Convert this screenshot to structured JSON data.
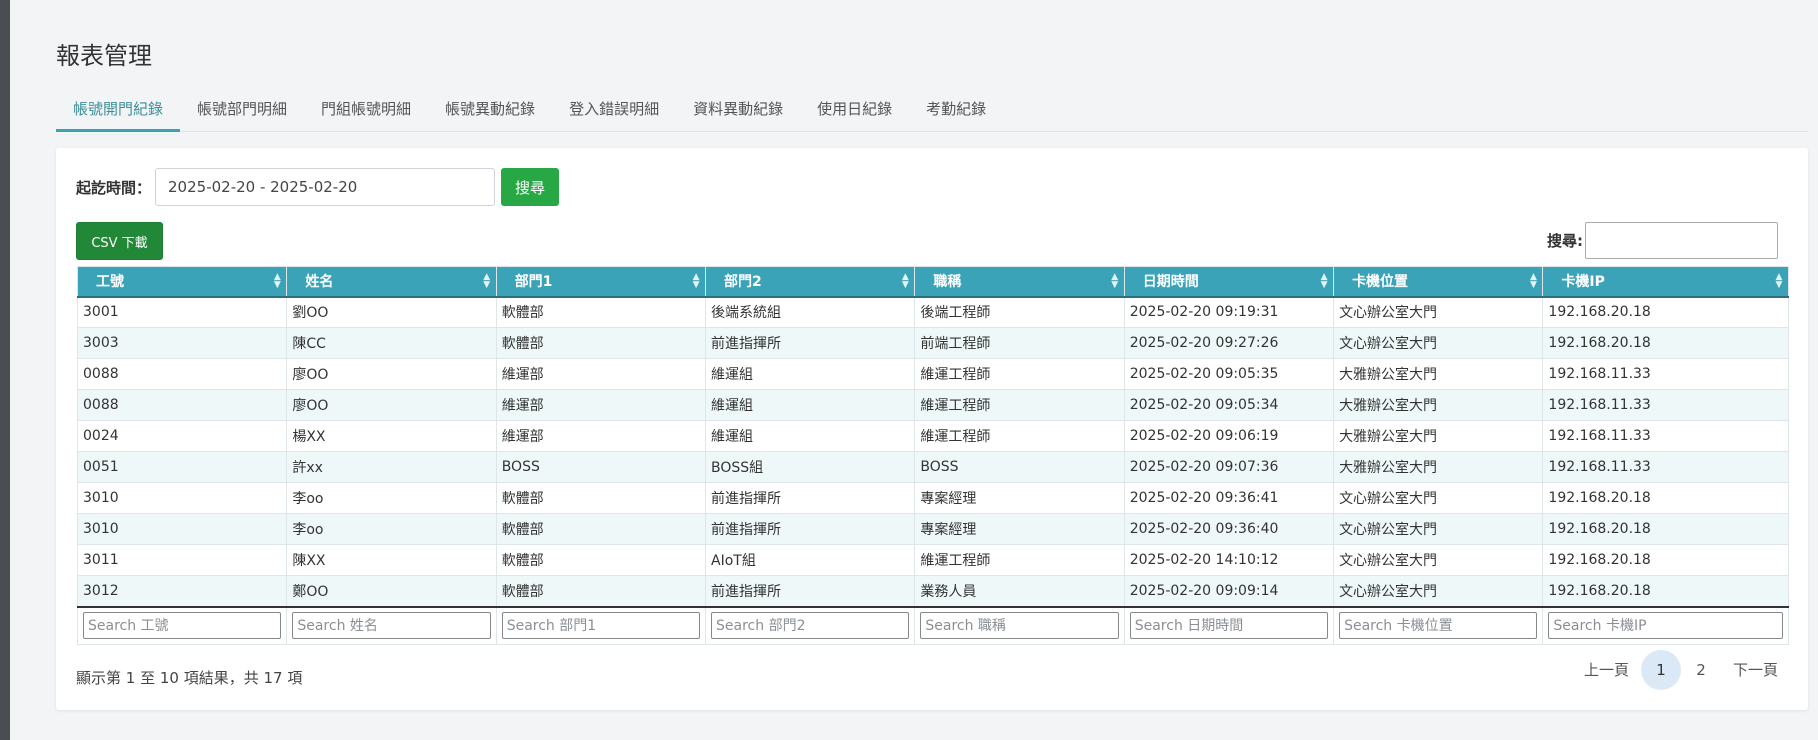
{
  "page": {
    "title": "報表管理"
  },
  "tabs": [
    {
      "label": "帳號開門紀錄",
      "active": true
    },
    {
      "label": "帳號部門明細",
      "active": false
    },
    {
      "label": "門組帳號明細",
      "active": false
    },
    {
      "label": "帳號異動紀錄",
      "active": false
    },
    {
      "label": "登入錯誤明細",
      "active": false
    },
    {
      "label": "資料異動紀錄",
      "active": false
    },
    {
      "label": "使用日紀錄",
      "active": false
    },
    {
      "label": "考勤紀錄",
      "active": false
    }
  ],
  "filter": {
    "label": "起訖時間：",
    "date_range": "2025-02-20 - 2025-02-20",
    "search_button": "搜尋"
  },
  "csv_button": "CSV 下載",
  "global_search": {
    "label": "搜尋:",
    "value": ""
  },
  "table": {
    "columns": [
      "工號",
      "姓名",
      "部門1",
      "部門2",
      "職稱",
      "日期時間",
      "卡機位置",
      "卡機IP"
    ],
    "rows": [
      [
        "3001",
        "劉OO",
        "軟體部",
        "後端系統組",
        "後端工程師",
        "2025-02-20 09:19:31",
        "文心辦公室大門",
        "192.168.20.18"
      ],
      [
        "3003",
        "陳CC",
        "軟體部",
        "前進指揮所",
        "前端工程師",
        "2025-02-20 09:27:26",
        "文心辦公室大門",
        "192.168.20.18"
      ],
      [
        "0088",
        "廖OO",
        "維運部",
        "維運組",
        "維運工程師",
        "2025-02-20 09:05:35",
        "大雅辦公室大門",
        "192.168.11.33"
      ],
      [
        "0088",
        "廖OO",
        "維運部",
        "維運組",
        "維運工程師",
        "2025-02-20 09:05:34",
        "大雅辦公室大門",
        "192.168.11.33"
      ],
      [
        "0024",
        "楊XX",
        "維運部",
        "維運組",
        "維運工程師",
        "2025-02-20 09:06:19",
        "大雅辦公室大門",
        "192.168.11.33"
      ],
      [
        "0051",
        "許xx",
        "BOSS",
        "BOSS組",
        "BOSS",
        "2025-02-20 09:07:36",
        "大雅辦公室大門",
        "192.168.11.33"
      ],
      [
        "3010",
        "李oo",
        "軟體部",
        "前進指揮所",
        "專案經理",
        "2025-02-20 09:36:41",
        "文心辦公室大門",
        "192.168.20.18"
      ],
      [
        "3010",
        "李oo",
        "軟體部",
        "前進指揮所",
        "專案經理",
        "2025-02-20 09:36:40",
        "文心辦公室大門",
        "192.168.20.18"
      ],
      [
        "3011",
        "陳XX",
        "軟體部",
        "AIoT組",
        "維運工程師",
        "2025-02-20 14:10:12",
        "文心辦公室大門",
        "192.168.20.18"
      ],
      [
        "3012",
        "鄭OO",
        "軟體部",
        "前進指揮所",
        "業務人員",
        "2025-02-20 09:09:14",
        "文心辦公室大門",
        "192.168.20.18"
      ]
    ],
    "column_search_placeholders": [
      "Search 工號",
      "Search 姓名",
      "Search 部門1",
      "Search 部門2",
      "Search 職稱",
      "Search 日期時間",
      "Search 卡機位置",
      "Search 卡機IP"
    ]
  },
  "info_text": "顯示第 1 至 10 項結果，共 17 項",
  "pagination": {
    "prev": "上一頁",
    "pages": [
      "1",
      "2"
    ],
    "current": "1",
    "next": "下一頁"
  },
  "colors": {
    "header_bg": "#3aa3b8",
    "active_tab": "#3aa3ad",
    "green_button": "#28a745",
    "stripe_row": "#eef8f8"
  }
}
